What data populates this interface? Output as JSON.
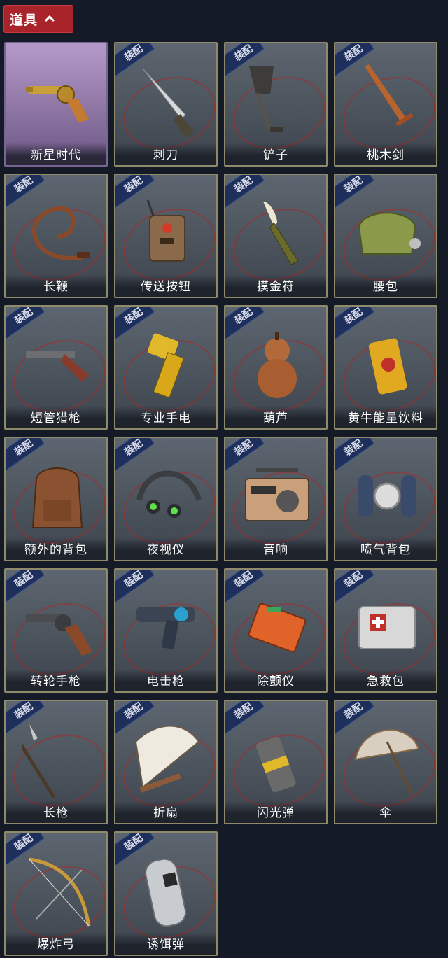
{
  "header": {
    "title": "道具"
  },
  "equip_label": "装配",
  "items": [
    {
      "label": "新星时代",
      "icon": "revolver-gold-icon",
      "special": true
    },
    {
      "label": "刺刀",
      "icon": "bayonet-icon"
    },
    {
      "label": "铲子",
      "icon": "shovel-icon"
    },
    {
      "label": "桃木剑",
      "icon": "wooden-sword-icon"
    },
    {
      "label": "长鞭",
      "icon": "whip-icon"
    },
    {
      "label": "传送按钮",
      "icon": "teleport-button-icon"
    },
    {
      "label": "摸金符",
      "icon": "tooth-amulet-icon"
    },
    {
      "label": "腰包",
      "icon": "waist-bag-icon"
    },
    {
      "label": "短管猎枪",
      "icon": "shotgun-icon"
    },
    {
      "label": "专业手电",
      "icon": "flashlight-icon"
    },
    {
      "label": "葫芦",
      "icon": "gourd-icon"
    },
    {
      "label": "黄牛能量饮料",
      "icon": "energy-drink-icon"
    },
    {
      "label": "额外的背包",
      "icon": "backpack-icon"
    },
    {
      "label": "夜视仪",
      "icon": "night-vision-goggles-icon"
    },
    {
      "label": "音响",
      "icon": "boombox-icon"
    },
    {
      "label": "喷气背包",
      "icon": "jetpack-icon"
    },
    {
      "label": "转轮手枪",
      "icon": "revolver-icon"
    },
    {
      "label": "电击枪",
      "icon": "shock-gun-icon"
    },
    {
      "label": "除颤仪",
      "icon": "defibrillator-icon"
    },
    {
      "label": "急救包",
      "icon": "first-aid-kit-icon"
    },
    {
      "label": "长枪",
      "icon": "spear-icon"
    },
    {
      "label": "折扇",
      "icon": "folding-fan-icon"
    },
    {
      "label": "闪光弹",
      "icon": "flashbang-icon"
    },
    {
      "label": "伞",
      "icon": "umbrella-icon"
    },
    {
      "label": "爆炸弓",
      "icon": "explosive-bow-icon"
    },
    {
      "label": "诱饵弹",
      "icon": "decoy-grenade-icon"
    }
  ]
}
